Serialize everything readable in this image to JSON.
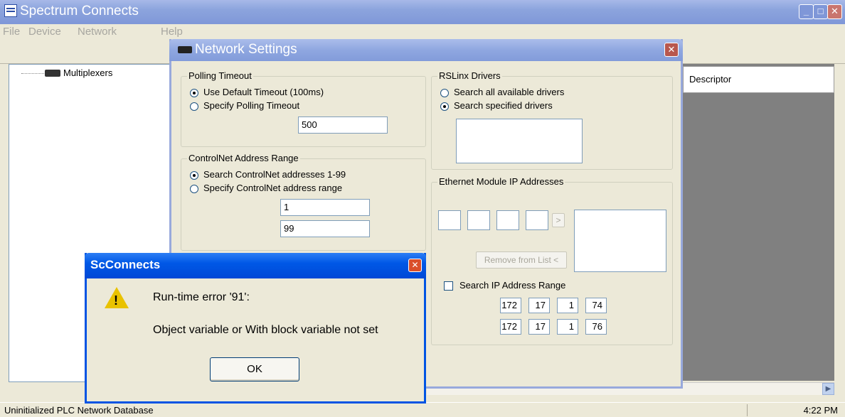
{
  "main_window": {
    "title": "Spectrum Connects",
    "menu": [
      "File",
      "Device",
      "Network",
      "Help"
    ],
    "tree_item": "Multiplexers",
    "grid_header": "Descriptor",
    "status_left": "Uninitialized PLC Network Database",
    "status_time": "4:22 PM"
  },
  "network_settings": {
    "title": "Network Settings",
    "polling": {
      "group": "Polling Timeout",
      "opt_default": "Use Default Timeout (100ms)",
      "opt_specify": "Specify Polling Timeout",
      "value": "500",
      "selected": "default"
    },
    "controlnet": {
      "group": "ControlNet Address Range",
      "opt_search": "Search ControlNet addresses 1-99",
      "opt_specify": "Specify ControlNet address range",
      "from": "1",
      "to": "99",
      "selected": "search"
    },
    "rslinx": {
      "group": "RSLinx Drivers",
      "opt_all": "Search all available drivers",
      "opt_specified": "Search specified drivers",
      "selected": "specified"
    },
    "ethernet": {
      "group": "Ethernet Module IP Addresses",
      "add_button": ">",
      "remove_button": "Remove from List <",
      "search_range_label": "Search IP Address Range",
      "search_range_checked": false,
      "range_start": [
        "172",
        "17",
        "1",
        "74"
      ],
      "range_end": [
        "172",
        "17",
        "1",
        "76"
      ]
    }
  },
  "error_dialog": {
    "title": "ScConnects",
    "line1": "Run-time error '91':",
    "line2": "Object variable or With block variable not set",
    "ok": "OK"
  },
  "colors": {
    "xp_blue": "#0054E3",
    "inactive_title": "#8FA7E0",
    "dialog_face": "#ECE9D8"
  }
}
